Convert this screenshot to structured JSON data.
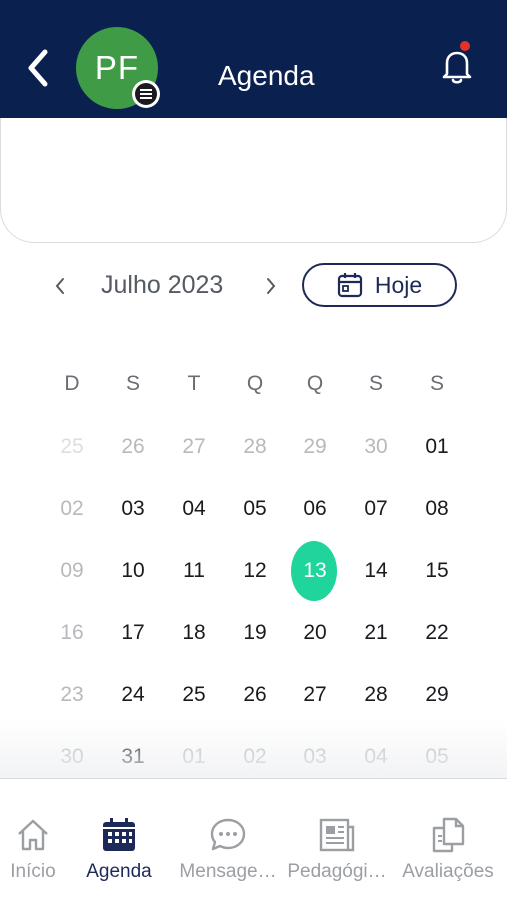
{
  "header": {
    "title": "Agenda",
    "avatar_initials": "PF",
    "avatar_color": "#3f9b46",
    "header_color": "#0a2150",
    "notification_dot_color": "#e5312a"
  },
  "calendar": {
    "month_label": "Julho 2023",
    "today_label": "Hoje",
    "weekdays": [
      "D",
      "S",
      "T",
      "Q",
      "Q",
      "S",
      "S"
    ],
    "selected_color": "#1fd59b",
    "weeks": [
      [
        {
          "d": "25",
          "s": "faded"
        },
        {
          "d": "26",
          "s": "outside"
        },
        {
          "d": "27",
          "s": "outside"
        },
        {
          "d": "28",
          "s": "outside"
        },
        {
          "d": "29",
          "s": "outside"
        },
        {
          "d": "30",
          "s": "outside"
        },
        {
          "d": "01",
          "s": "current"
        }
      ],
      [
        {
          "d": "02",
          "s": "outside"
        },
        {
          "d": "03",
          "s": "current"
        },
        {
          "d": "04",
          "s": "current"
        },
        {
          "d": "05",
          "s": "current"
        },
        {
          "d": "06",
          "s": "current"
        },
        {
          "d": "07",
          "s": "current"
        },
        {
          "d": "08",
          "s": "current"
        }
      ],
      [
        {
          "d": "09",
          "s": "outside"
        },
        {
          "d": "10",
          "s": "current"
        },
        {
          "d": "11",
          "s": "current"
        },
        {
          "d": "12",
          "s": "current"
        },
        {
          "d": "13",
          "s": "selected"
        },
        {
          "d": "14",
          "s": "current"
        },
        {
          "d": "15",
          "s": "current"
        }
      ],
      [
        {
          "d": "16",
          "s": "outside"
        },
        {
          "d": "17",
          "s": "current"
        },
        {
          "d": "18",
          "s": "current"
        },
        {
          "d": "19",
          "s": "current"
        },
        {
          "d": "20",
          "s": "current"
        },
        {
          "d": "21",
          "s": "current"
        },
        {
          "d": "22",
          "s": "current"
        }
      ],
      [
        {
          "d": "23",
          "s": "outside"
        },
        {
          "d": "24",
          "s": "current"
        },
        {
          "d": "25",
          "s": "current"
        },
        {
          "d": "26",
          "s": "current"
        },
        {
          "d": "27",
          "s": "current"
        },
        {
          "d": "28",
          "s": "current"
        },
        {
          "d": "29",
          "s": "current"
        }
      ],
      [
        {
          "d": "30",
          "s": "outside"
        },
        {
          "d": "31",
          "s": "current"
        },
        {
          "d": "01",
          "s": "outside"
        },
        {
          "d": "02",
          "s": "outside"
        },
        {
          "d": "03",
          "s": "outside"
        },
        {
          "d": "04",
          "s": "outside"
        },
        {
          "d": "05",
          "s": "outside"
        }
      ]
    ]
  },
  "bottom_nav": {
    "items": [
      {
        "label": "Início",
        "icon": "home-icon",
        "active": false
      },
      {
        "label": "Agenda",
        "icon": "calendar-icon",
        "active": true
      },
      {
        "label": "Mensage…",
        "icon": "chat-icon",
        "active": false
      },
      {
        "label": "Pedagógi…",
        "icon": "newspaper-icon",
        "active": false
      },
      {
        "label": "Avaliações",
        "icon": "documents-icon",
        "active": false
      }
    ]
  }
}
